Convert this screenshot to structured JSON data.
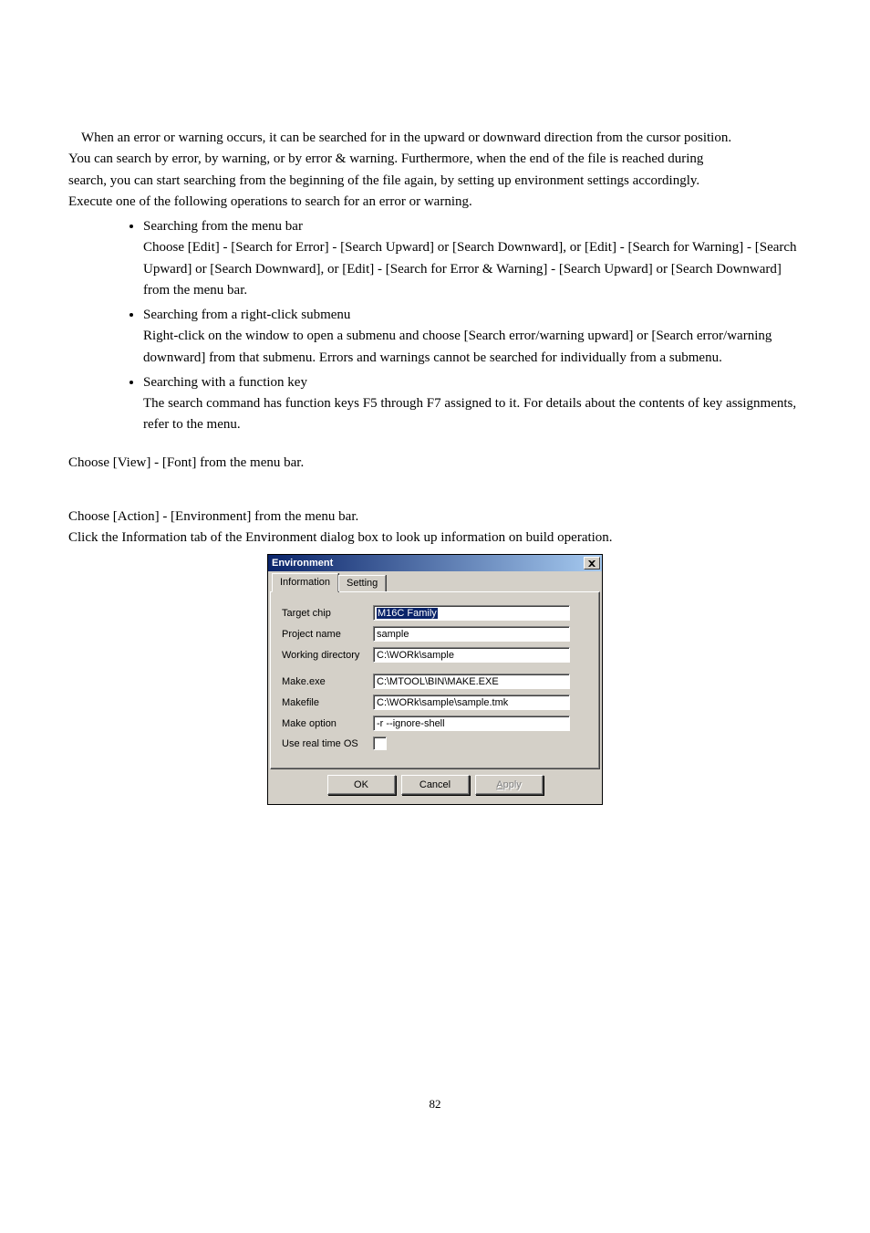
{
  "intro": {
    "p1_line1": "When an error or warning occurs, it can be searched for in the upward or downward direction from the cursor position.",
    "p1_line2": "You can search by error, by warning, or by error & warning. Furthermore, when the end of the file is reached during",
    "p1_line3": "search, you can start searching from the beginning of the file again, by setting up environment settings accordingly.",
    "p1_line4": "Execute one of the following operations to search for an error or warning."
  },
  "bullet1": {
    "title": "Searching from the menu bar",
    "body": "Choose [Edit] - [Search for Error] - [Search Upward] or [Search Downward], or [Edit] - [Search for Warning] - [Search Upward] or [Search Downward], or [Edit] - [Search for Error & Warning] - [Search Upward] or [Search Downward] from the menu bar."
  },
  "bullet2": {
    "title": "Searching from a right-click submenu",
    "body": "Right-click on the window to open a submenu and choose [Search error/warning upward] or [Search error/warning downward] from that submenu. Errors and warnings cannot be searched for individually from a submenu."
  },
  "bullet3": {
    "title": "Searching with a function key",
    "body": "The search command has function keys F5 through F7 assigned to it. For details about the contents of key assignments, refer to the menu."
  },
  "step1": "Choose [View] - [Font] from the menu bar.",
  "step2a": "Choose [Action] - [Environment] from the menu bar.",
  "step2b": "Click the Information tab of the Environment dialog box to look up information on build operation.",
  "dialog": {
    "title": "Environment",
    "tabs": {
      "active": "Information",
      "inactive": "Setting"
    },
    "rows": {
      "target_chip": {
        "label": "Target chip",
        "value": "M16C Family"
      },
      "project_name": {
        "label": "Project name",
        "value": "sample"
      },
      "working_dir": {
        "label": "Working directory",
        "value": "C:\\WORk\\sample"
      },
      "make_exe": {
        "label": "Make.exe",
        "value": "C:\\MTOOL\\BIN\\MAKE.EXE"
      },
      "makefile": {
        "label": "Makefile",
        "value": "C:\\WORk\\sample\\sample.tmk"
      },
      "make_option": {
        "label": "Make option",
        "value": "-r --ignore-shell"
      },
      "use_rtos": {
        "label": "Use real time OS"
      }
    },
    "buttons": {
      "ok": "OK",
      "cancel": "Cancel",
      "apply_pre": "A",
      "apply_post": "pply"
    }
  },
  "page_number": "82"
}
